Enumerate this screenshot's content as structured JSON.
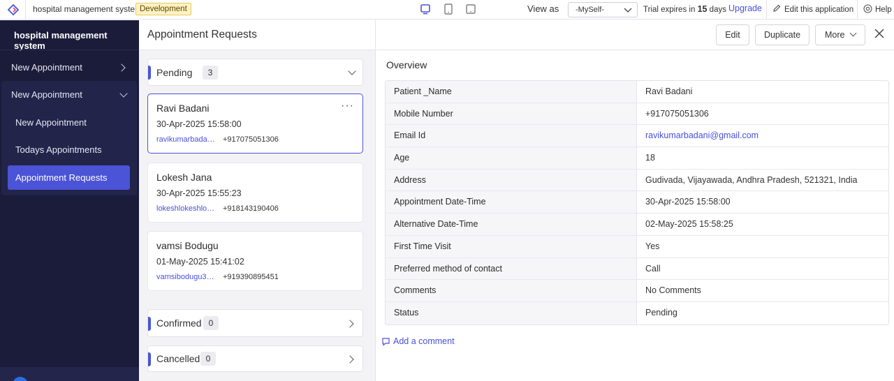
{
  "topbar": {
    "app_name": "hospital management system",
    "env_badge": "Development",
    "view_as_label": "View as",
    "view_as_value": "-MySelf-",
    "trial_prefix": "Trial expires in",
    "trial_days": "15",
    "trial_suffix": "days",
    "upgrade": "Upgrade",
    "edit_app": "Edit this application",
    "help": "Help"
  },
  "sidebar": {
    "brand": "hospital management system",
    "items": [
      {
        "label": "New Appointment"
      },
      {
        "label": "New Appointment"
      },
      {
        "label": "New Appointment"
      },
      {
        "label": "Todays Appointments"
      },
      {
        "label": "Appointment Requests"
      }
    ]
  },
  "list": {
    "title": "Appointment Requests",
    "pending": {
      "label": "Pending",
      "count": "3"
    },
    "confirmed": {
      "label": "Confirmed",
      "count": "0"
    },
    "cancelled": {
      "label": "Cancelled",
      "count": "0"
    },
    "cards": [
      {
        "name": "Ravi Badani",
        "datetime": "30-Apr-2025 15:58:00",
        "email": "ravikumarbadan...",
        "phone": "+917075051306",
        "more": "···"
      },
      {
        "name": "Lokesh Jana",
        "datetime": "30-Apr-2025 15:55:23",
        "email": "lokeshlokeshlok...",
        "phone": "+918143190406"
      },
      {
        "name": "vamsi Bodugu",
        "datetime": "01-May-2025 15:41:02",
        "email": "vamsibodugu38...",
        "phone": "+919390895451"
      }
    ]
  },
  "detail": {
    "buttons": {
      "edit": "Edit",
      "duplicate": "Duplicate",
      "more": "More"
    },
    "overview_title": "Overview",
    "fields": [
      {
        "key": "Patient _Name",
        "value": "Ravi Badani"
      },
      {
        "key": "Mobile Number",
        "value": "+917075051306"
      },
      {
        "key": "Email Id",
        "value": "ravikumarbadani@gmail.com"
      },
      {
        "key": "Age",
        "value": "18"
      },
      {
        "key": "Address",
        "value": "Gudivada, Vijayawada, Andhra Pradesh, 521321, India"
      },
      {
        "key": "Appointment Date-Time",
        "value": "30-Apr-2025 15:58:00"
      },
      {
        "key": "Alternative Date-Time",
        "value": "02-May-2025 15:58:25"
      },
      {
        "key": "First Time Visit",
        "value": "Yes"
      },
      {
        "key": "Preferred method of contact",
        "value": "Call"
      },
      {
        "key": "Comments",
        "value": "No Comments"
      },
      {
        "key": "Status",
        "value": "Pending"
      }
    ],
    "add_comment": "Add a comment"
  },
  "colors": {
    "accent": "#4b53d6",
    "sidebar_bg": "#1b1c3a",
    "link": "#4a4fd9",
    "badge_bg": "#fff3c4"
  },
  "icons": [
    "app-logo-icon",
    "desktop-icon",
    "tablet-icon",
    "mobile-icon",
    "chevron-down-icon",
    "pencil-icon",
    "help-icon",
    "chevron-right-icon",
    "more-dots-icon",
    "close-icon",
    "comment-icon"
  ]
}
